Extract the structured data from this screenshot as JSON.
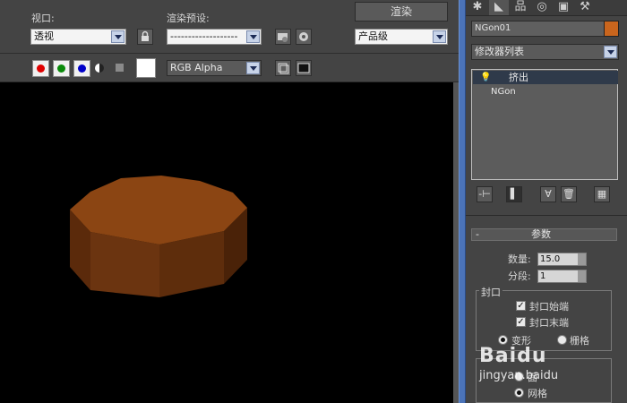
{
  "toolbar": {
    "viewport_label": "视口:",
    "viewport_value": "透视",
    "render_preset_label": "渲染预设:",
    "render_preset_value": "-------------------",
    "render_button": "渲染",
    "quality_value": "产品级",
    "channel_value": "RGB Alpha"
  },
  "command_panel": {
    "object_name": "NGon01",
    "object_color": "#c9651d",
    "modifier_list": "修改器列表",
    "stack": [
      {
        "label": "挤出",
        "selected": true
      },
      {
        "label": "NGon",
        "selected": false
      }
    ],
    "rollout_title": "参数",
    "rollout_toggle": "-",
    "amount_label": "数量:",
    "amount_value": "15.0",
    "segments_label": "分段:",
    "segments_value": "1",
    "cap_group": "封口",
    "cap_start": "封口始端",
    "cap_end": "封口末端",
    "morph": "变形",
    "grid": "栅格",
    "output_partial": "面",
    "grid2": "网格"
  },
  "watermark": {
    "brand": "Baidu",
    "site": "jingyan.baidu"
  }
}
